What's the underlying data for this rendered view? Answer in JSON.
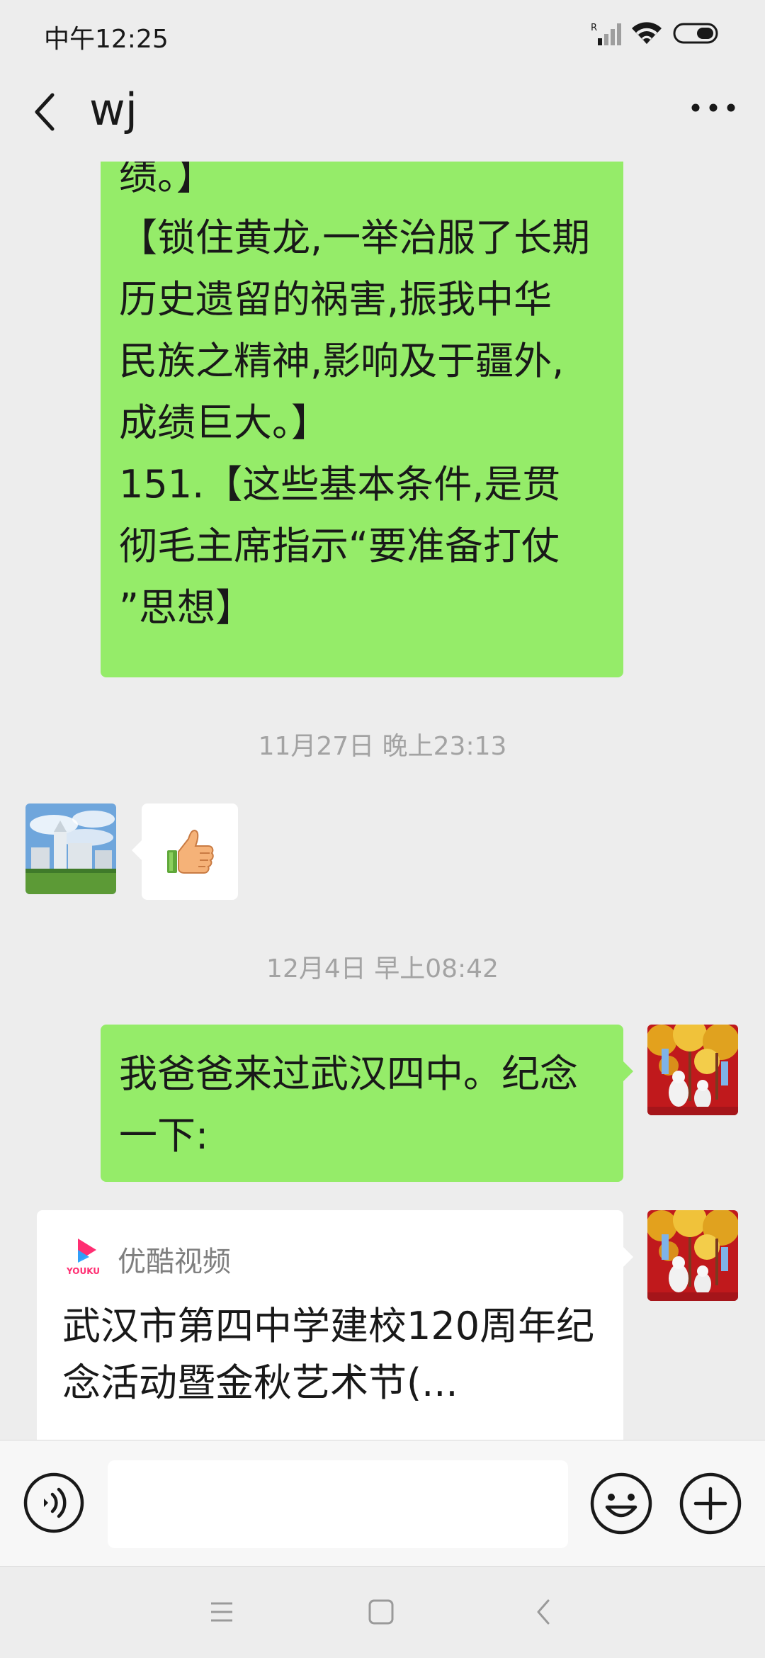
{
  "status_bar": {
    "time": "中午12:25",
    "signal_badge": "R"
  },
  "header": {
    "title": "wj"
  },
  "messages": {
    "long_text_lines": [
      "绩。】",
      "【锁住黄龙,一举治服了长期",
      "历史遗留的祸害,振我中华",
      "民族之精神,影响及于疆外,",
      "成绩巨大。】",
      "151.【这些基本条件,是贯",
      "彻毛主席指示“要准备打仗",
      "”思想】"
    ],
    "timestamp_1": "11月27日 晚上23:13",
    "sticker_icon": "thumbs-up-icon",
    "timestamp_2": "12月4日 早上08:42",
    "short_text": "我爸爸来过武汉四中。纪念一下:",
    "card": {
      "source": "优酷视频",
      "source_logo_text": "YOUKU",
      "title": "武汉市第四中学建校120周年纪念活动暨金秋艺术节(..."
    }
  },
  "input_bar": {
    "value": "",
    "placeholder": ""
  },
  "colors": {
    "bubble_sent": "#95ec69",
    "bubble_received": "#ffffff",
    "background": "#ededed",
    "timestamp": "#a3a3a3",
    "youku_pink": "#ff2e72",
    "youku_blue": "#25a4ff"
  }
}
